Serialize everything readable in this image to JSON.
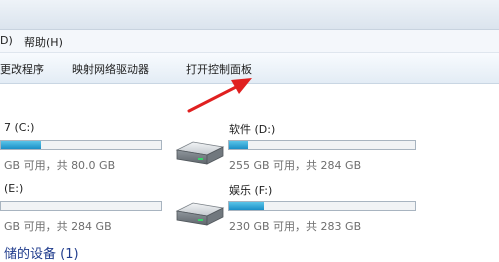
{
  "menu": {
    "item1": "D)",
    "help": "帮助(H)"
  },
  "toolbar": {
    "uninstall": "更改程序",
    "map_drive": "映射网络驱动器",
    "open_control_panel": "打开控制面板"
  },
  "drives": [
    {
      "name": "7 (C:)",
      "usage": "GB 可用，共 80.0 GB",
      "fill": 0.25
    },
    {
      "name": "软件 (D:)",
      "usage": "255 GB 可用，共 284 GB",
      "fill": 0.1
    },
    {
      "name": "(E:)",
      "usage": "GB 可用，共 284 GB",
      "fill": 0.0
    },
    {
      "name": "娱乐 (F:)",
      "usage": "230 GB 可用，共 283 GB",
      "fill": 0.19
    }
  ],
  "section": {
    "removable": "储的设备 (1)"
  },
  "colors": {
    "arrow": "#e02020",
    "bar_fill": "#1b8fc7",
    "section_title": "#1f3b8c"
  },
  "icons": {
    "drive": "hard-drive-icon",
    "arrow": "red-arrow-annotation"
  }
}
